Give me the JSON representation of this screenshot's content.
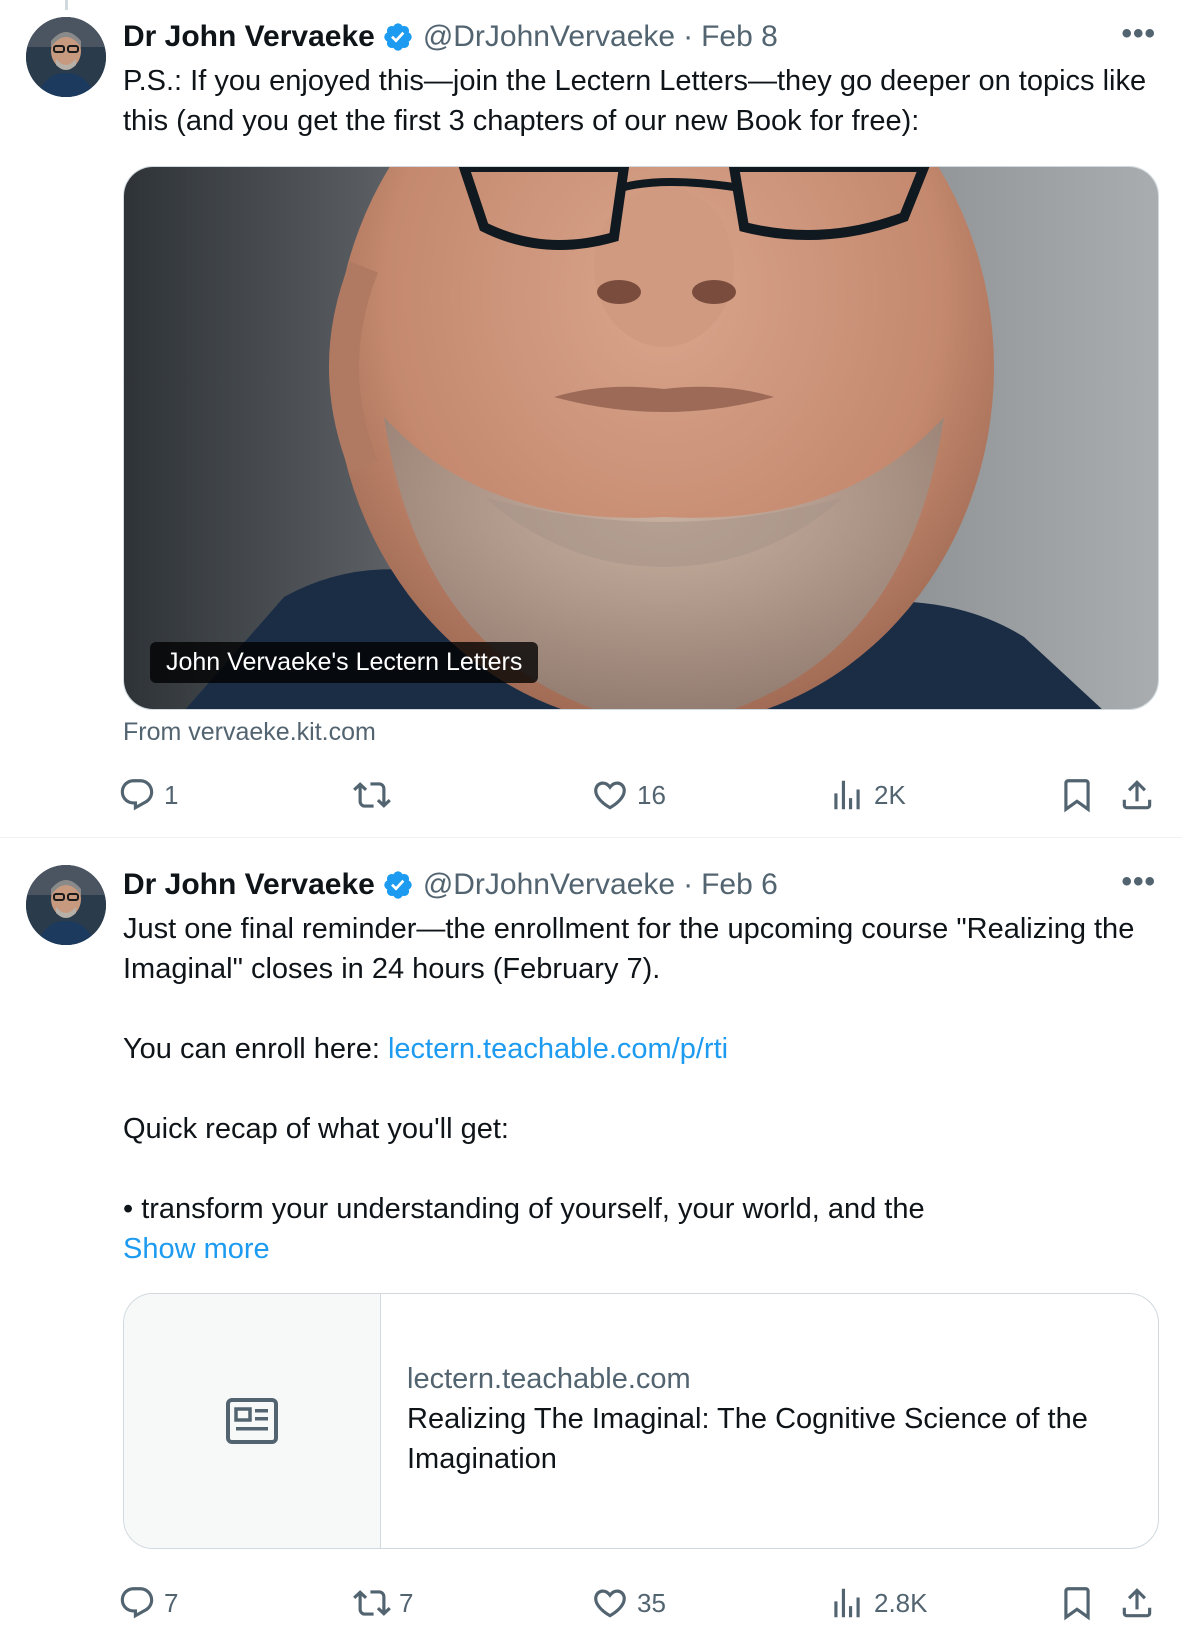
{
  "colors": {
    "link": "#1d9bf0",
    "muted": "#536471",
    "verified": "#1d9bf0",
    "text": "#0f1419"
  },
  "tweets": [
    {
      "author_name": "Dr John Vervaeke",
      "handle": "@DrJohnVervaeke",
      "separator": "·",
      "date": "Feb 8",
      "more_icon": "more-horizontal-icon",
      "text_line1": "P.S.: If you enjoyed this—join the Lectern Letters—they go deeper on topics like this (and you get the first 3 chapters of our new Book for free):",
      "media_caption": "John Vervaeke's Lectern Letters",
      "media_source": "From vervaeke.kit.com",
      "replies": "1",
      "retweets": "",
      "likes": "16",
      "views": "2K"
    },
    {
      "author_name": "Dr John Vervaeke",
      "handle": "@DrJohnVervaeke",
      "separator": "·",
      "date": "Feb 6",
      "more_icon": "more-horizontal-icon",
      "para1": "Just one final reminder—the enrollment for the upcoming course \"Realizing the Imaginal\" closes in 24 hours (February 7).",
      "para2_prefix": "You can enroll here: ",
      "para2_link": "lectern.teachable.com/p/rti",
      "para3": "Quick recap of what you'll get:",
      "para4": "• transform your understanding of yourself, your world, and the",
      "show_more": "Show more",
      "card_domain": "lectern.teachable.com",
      "card_title": "Realizing The Imaginal: The Cognitive Science of the Imagination",
      "card_icon": "article-icon",
      "replies": "7",
      "retweets": "7",
      "likes": "35",
      "views": "2.8K"
    }
  ]
}
